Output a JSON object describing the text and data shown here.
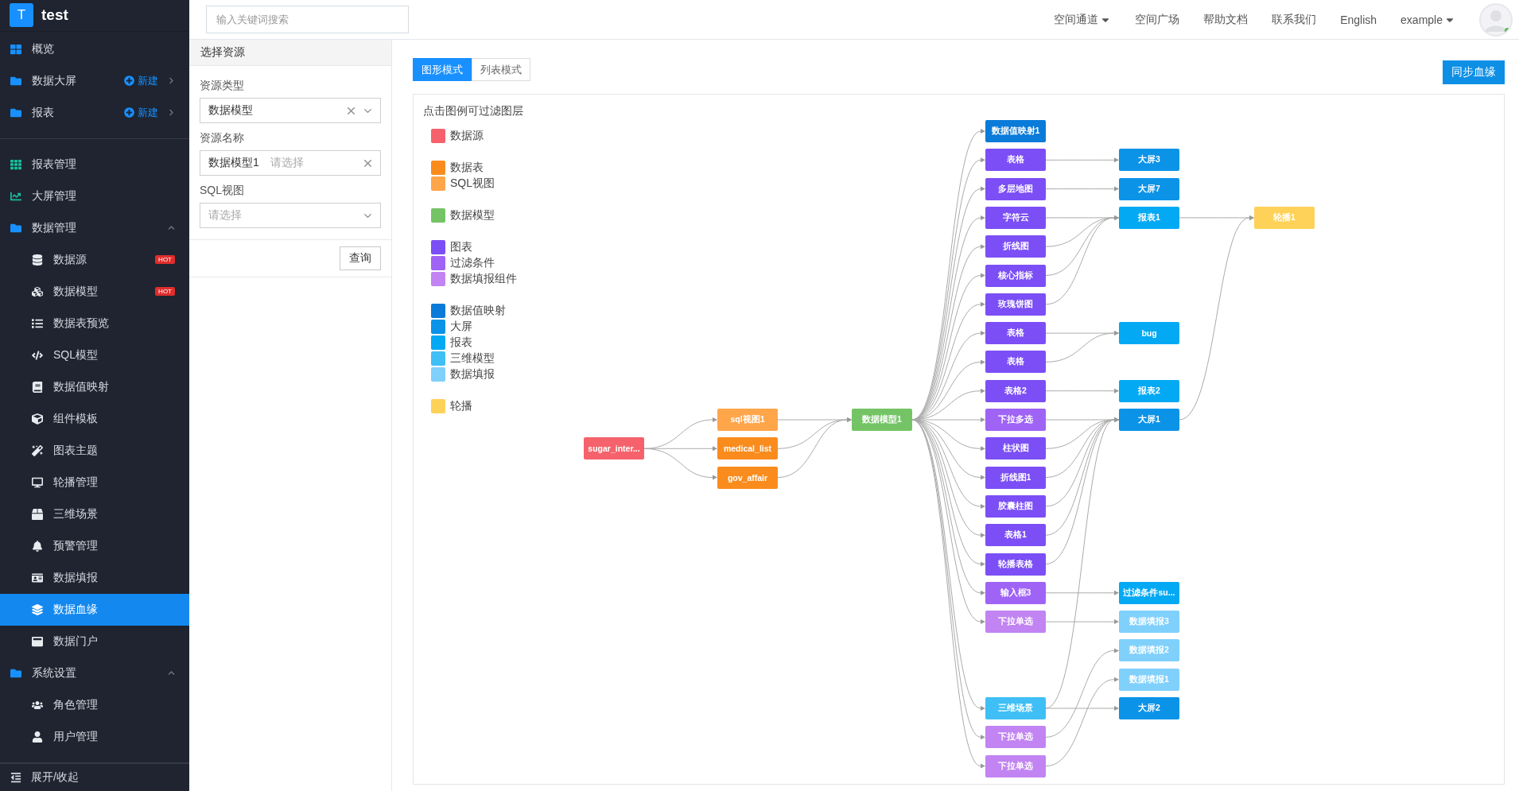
{
  "sidebar": {
    "logo": "T",
    "title": "test",
    "sections": [
      {
        "items": [
          {
            "kind": "top",
            "label": "概览",
            "selected": false
          },
          {
            "kind": "top",
            "label": "数据大屏",
            "action": "新建",
            "selected": false
          },
          {
            "kind": "top",
            "label": "报表",
            "action": "新建",
            "selected": false
          }
        ]
      },
      {
        "items": [
          {
            "kind": "top",
            "label": "报表管理",
            "selected": false
          },
          {
            "kind": "top",
            "label": "大屏管理",
            "selected": false
          },
          {
            "kind": "group",
            "label": "数据管理",
            "expanded": true,
            "selected": false,
            "children": [
              {
                "kind": "sub",
                "label": "数据源",
                "badge": "HOT",
                "selected": false
              },
              {
                "kind": "sub",
                "label": "数据模型",
                "badge": "HOT",
                "selected": false
              },
              {
                "kind": "sub",
                "label": "数据表预览",
                "selected": false
              },
              {
                "kind": "sub",
                "label": "SQL模型",
                "selected": false
              },
              {
                "kind": "sub",
                "label": "数据值映射",
                "selected": false
              },
              {
                "kind": "sub",
                "label": "组件模板",
                "selected": false
              },
              {
                "kind": "sub",
                "label": "图表主题",
                "selected": false
              },
              {
                "kind": "sub",
                "label": "轮播管理",
                "selected": false
              },
              {
                "kind": "sub",
                "label": "三维场景",
                "selected": false
              },
              {
                "kind": "sub",
                "label": "预警管理",
                "selected": false
              },
              {
                "kind": "sub",
                "label": "数据填报",
                "selected": false
              },
              {
                "kind": "sub",
                "label": "数据血缘",
                "selected": true
              },
              {
                "kind": "sub",
                "label": "数据门户",
                "selected": false
              }
            ]
          },
          {
            "kind": "group",
            "label": "系统设置",
            "expanded": true,
            "selected": false,
            "children": [
              {
                "kind": "sub",
                "label": "角色管理",
                "selected": false
              },
              {
                "kind": "sub",
                "label": "用户管理",
                "selected": false
              }
            ]
          }
        ]
      }
    ],
    "footer": "展开/收起"
  },
  "topbar": {
    "search": {
      "placeholder": "输入关键词搜索"
    },
    "nav": [
      {
        "label": "空间通道",
        "dropdown": true
      },
      {
        "label": "空间广场",
        "dropdown": false
      },
      {
        "label": "帮助文档",
        "dropdown": false
      },
      {
        "label": "联系我们",
        "dropdown": false
      },
      {
        "label": "English",
        "dropdown": false
      },
      {
        "label": "example",
        "dropdown": true
      }
    ],
    "online": true
  },
  "filter": {
    "title": "选择资源",
    "fields": [
      {
        "kind": "select",
        "label": "资源类型",
        "value": "数据模型",
        "clearable": true
      },
      {
        "kind": "tags",
        "label": "资源名称",
        "value": "数据模型1",
        "placeholder": "请选择",
        "clearable": true
      },
      {
        "kind": "select",
        "label": "SQL视图",
        "placeholder": "请选择",
        "clearable": false
      }
    ],
    "submit": "查询"
  },
  "tabs": [
    {
      "label": "图形模式",
      "selected": true
    },
    {
      "label": "列表模式",
      "selected": false
    }
  ],
  "sync_button": "同步血缘",
  "graph": {
    "hint": "点击图例可过滤图层",
    "legend": [
      [
        {
          "label": "数据源",
          "color": "#f5626b"
        }
      ],
      [
        {
          "label": "数据表",
          "color": "#fa8c1e"
        },
        {
          "label": "SQL视图",
          "color": "#ffa54a"
        }
      ],
      [
        {
          "label": "数据模型",
          "color": "#74c466"
        }
      ],
      [
        {
          "label": "图表",
          "color": "#7b4ff5"
        },
        {
          "label": "过滤条件",
          "color": "#9f63f5"
        },
        {
          "label": "数据填报组件",
          "color": "#c184f2"
        }
      ],
      [
        {
          "label": "数据值映射",
          "color": "#0a7bd8"
        },
        {
          "label": "大屏",
          "color": "#0b93e8"
        },
        {
          "label": "报表",
          "color": "#04a9f4"
        },
        {
          "label": "三维模型",
          "color": "#3fbff5"
        },
        {
          "label": "数据填报",
          "color": "#80d0fc"
        }
      ],
      [
        {
          "label": "轮播",
          "color": "#fed158"
        }
      ]
    ],
    "nodes": [
      {
        "label": "sugar_inter...",
        "color": "#f5626b"
      },
      {
        "label": "sql视图1",
        "color": "#ffa54a"
      },
      {
        "label": "medical_list",
        "color": "#fa8c1e"
      },
      {
        "label": "gov_affair",
        "color": "#fa8c1e"
      },
      {
        "label": "数据模型1",
        "color": "#74c466"
      },
      {
        "label": "数据值映射1",
        "color": "#0a7bd8"
      },
      {
        "label": "表格",
        "color": "#7b4ff5"
      },
      {
        "label": "多层地图",
        "color": "#7b4ff5"
      },
      {
        "label": "字符云",
        "color": "#7b4ff5"
      },
      {
        "label": "折线图",
        "color": "#7b4ff5"
      },
      {
        "label": "核心指标",
        "color": "#7b4ff5"
      },
      {
        "label": "玫瑰饼图",
        "color": "#7b4ff5"
      },
      {
        "label": "表格",
        "color": "#7b4ff5"
      },
      {
        "label": "表格",
        "color": "#7b4ff5"
      },
      {
        "label": "表格2",
        "color": "#7b4ff5"
      },
      {
        "label": "下拉多选",
        "color": "#9f63f5"
      },
      {
        "label": "柱状图",
        "color": "#7b4ff5"
      },
      {
        "label": "折线图1",
        "color": "#7b4ff5"
      },
      {
        "label": "胶囊柱图",
        "color": "#7b4ff5"
      },
      {
        "label": "表格1",
        "color": "#7b4ff5"
      },
      {
        "label": "轮播表格",
        "color": "#7b4ff5"
      },
      {
        "label": "输入框3",
        "color": "#9f63f5"
      },
      {
        "label": "下拉单选",
        "color": "#c184f2"
      },
      {
        "label": "三维场景",
        "color": "#3fbff5"
      },
      {
        "label": "下拉单选",
        "color": "#c184f2"
      },
      {
        "label": "下拉单选",
        "color": "#c184f2"
      },
      {
        "label": "大屏3",
        "color": "#0b93e8"
      },
      {
        "label": "大屏7",
        "color": "#0b93e8"
      },
      {
        "label": "报表1",
        "color": "#04a9f4"
      },
      {
        "label": "bug",
        "color": "#04a9f4"
      },
      {
        "label": "报表2",
        "color": "#04a9f4"
      },
      {
        "label": "大屏1",
        "color": "#0b93e8"
      },
      {
        "label": "过滤条件su...",
        "color": "#04a9f4"
      },
      {
        "label": "数据填报3",
        "color": "#80d0fc"
      },
      {
        "label": "数据填报2",
        "color": "#80d0fc"
      },
      {
        "label": "数据填报1",
        "color": "#80d0fc"
      },
      {
        "label": "大屏2",
        "color": "#0b93e8"
      },
      {
        "label": "轮播1",
        "color": "#fed158"
      }
    ]
  }
}
